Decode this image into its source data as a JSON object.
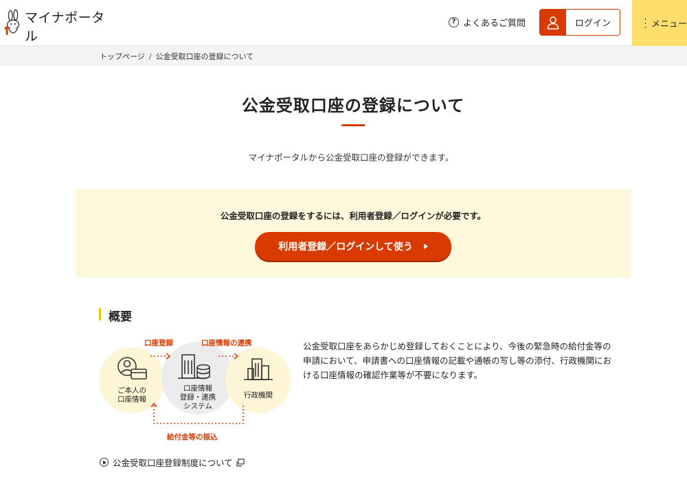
{
  "header": {
    "logo_text": "マイナポータル",
    "faq_label": "よくあるご質問",
    "login_label": "ログイン",
    "menu_label": "メニュー"
  },
  "breadcrumb": {
    "items": [
      "トップページ",
      "公金受取口座の登録について"
    ],
    "separator": "/"
  },
  "main": {
    "title": "公金受取口座の登録について",
    "lead": "マイナポータルから公金受取口座の登録ができます。"
  },
  "notice": {
    "text": "公金受取口座の登録をするには、利用者登録／ログインが必要です。",
    "button_label": "利用者登録／ログインして使う"
  },
  "overview": {
    "heading": "概要",
    "diagram": {
      "left_label_line1": "ご本人の",
      "left_label_line2": "口座情報",
      "mid_label_line1": "口座情報",
      "mid_label_line2": "登録・連携",
      "mid_label_line3": "システム",
      "right_label": "行政機関",
      "arrow_top_left": "口座登録",
      "arrow_top_right": "口座情報の連携",
      "arrow_bottom": "給付金等の振込"
    },
    "description": "公金受取口座をあらかじめ登録しておくことにより、今後の緊急時の給付金等の申請において、申請書への口座情報の記載や通帳の写し等の添付、行政機関における口座情報の確認作業等が不要になります。",
    "related_link": "公金受取口座登録制度について"
  },
  "colors": {
    "accent_red": "#d93a00",
    "menu_yellow": "#ffdf6b",
    "notice_bg": "#fdf7dc",
    "section_bar": "#f5c400"
  }
}
